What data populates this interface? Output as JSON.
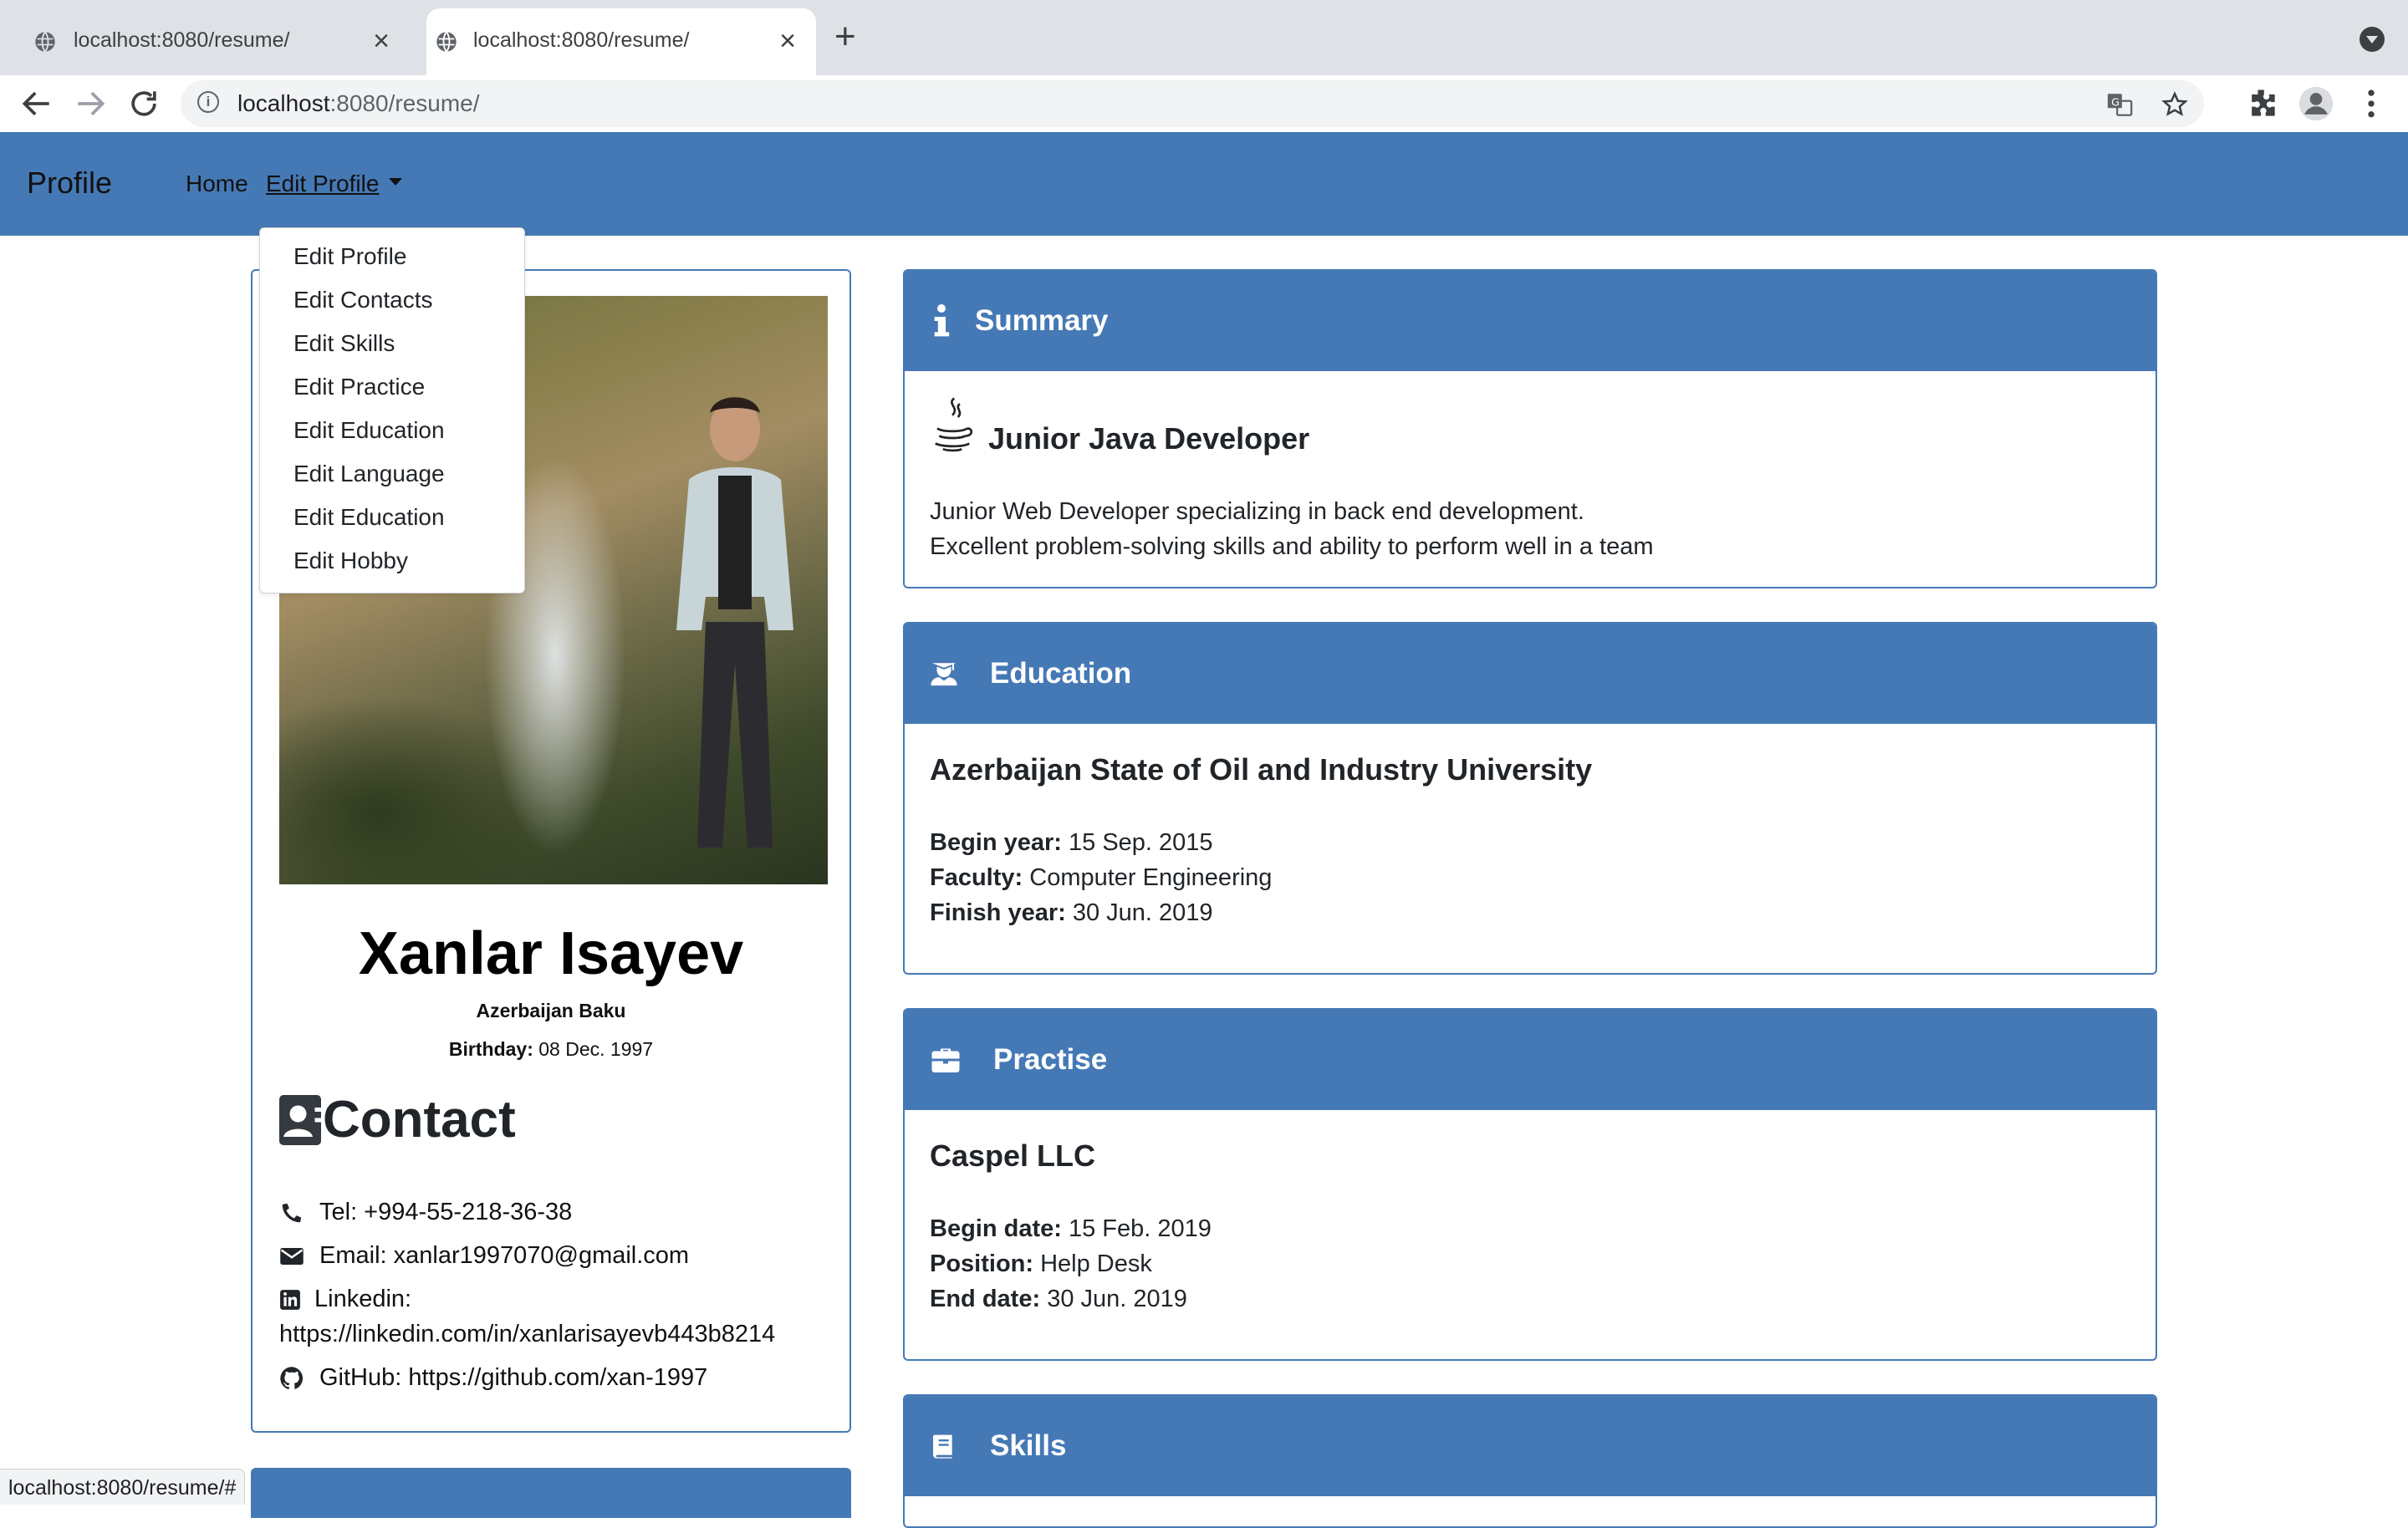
{
  "browser": {
    "tabs": [
      {
        "title": "localhost:8080/resume/"
      },
      {
        "title": "localhost:8080/resume/"
      }
    ],
    "url_host": "localhost",
    "url_path": ":8080/resume/",
    "status_url": "localhost:8080/resume/#"
  },
  "navbar": {
    "brand": "Profile",
    "home": "Home",
    "edit_profile": "Edit Profile",
    "dropdown": [
      "Edit Profile",
      "Edit Contacts",
      "Edit Skills",
      "Edit Practice",
      "Edit Education",
      "Edit Language",
      "Edit Education",
      "Edit Hobby"
    ]
  },
  "profile": {
    "name": "Xanlar Isayev",
    "location": "Azerbaijan Baku",
    "birthday_label": "Birthday:",
    "birthday": "08 Dec. 1997",
    "contact_title": "Contact",
    "tel": "Tel: +994-55-218-36-38",
    "email": "Email: xanlar1997070@gmail.com",
    "linkedin_label": "Linkedin:",
    "linkedin_url": "https://linkedin.com/in/xanlarisayevb443b8214",
    "github": "GitHub: https://github.com/xan-1997"
  },
  "summary": {
    "title": "Summary",
    "role": "Junior Java Developer",
    "line1": "Junior Web Developer specializing in back end development.",
    "line2": "Excellent problem-solving skills and ability to perform well in a team"
  },
  "education": {
    "title": "Education",
    "school": "Azerbaijan State of Oil and Industry University",
    "begin_label": "Begin year:",
    "begin": "15 Sep. 2015",
    "faculty_label": "Faculty:",
    "faculty": "Computer Engineering",
    "finish_label": "Finish year:",
    "finish": "30 Jun. 2019"
  },
  "practise": {
    "title": "Practise",
    "company": "Caspel LLC",
    "begin_label": "Begin date:",
    "begin": "15 Feb. 2019",
    "position_label": "Position:",
    "position": "Help Desk",
    "end_label": "End date:",
    "end": "30 Jun. 2019"
  },
  "skills": {
    "title": "Skills"
  },
  "colors": {
    "primary": "#4579b5",
    "text": "#212529"
  }
}
